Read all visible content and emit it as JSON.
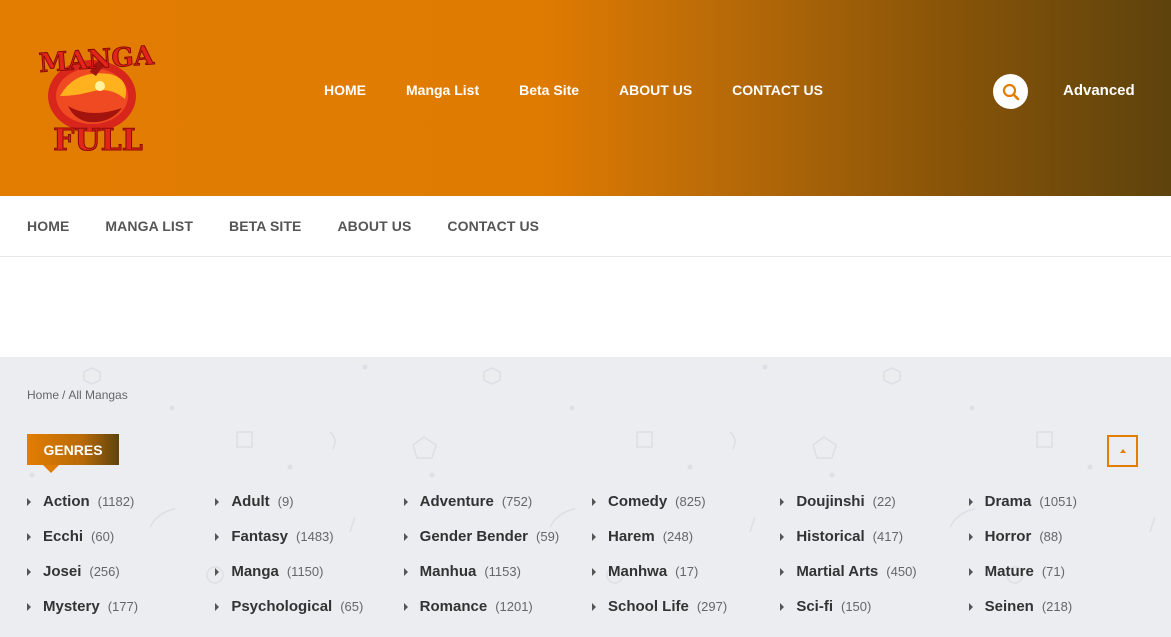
{
  "logo": {
    "line1": "MANGA",
    "line2": "FULL"
  },
  "top_nav": [
    "HOME",
    "Manga List",
    "Beta Site",
    "ABOUT US",
    "CONTACT US"
  ],
  "advanced_label": "Advanced",
  "sub_nav": [
    "HOME",
    "MANGA LIST",
    "BETA SITE",
    "ABOUT US",
    "CONTACT US"
  ],
  "breadcrumb": {
    "home": "Home",
    "sep": "/",
    "current": "All Mangas"
  },
  "genres_title": "GENRES",
  "icons": {
    "search": "search-icon",
    "scroll_top": "caret-up-icon",
    "genre_bullet": "caret-right-icon"
  },
  "colors": {
    "brand_orange": "#e27d02",
    "brand_dark": "#5e430d",
    "gray_bg": "#ebedf1"
  },
  "genres": [
    [
      {
        "name": "Action",
        "count": "(1182)"
      },
      {
        "name": "Adult",
        "count": "(9)"
      },
      {
        "name": "Adventure",
        "count": "(752)"
      },
      {
        "name": "Comedy",
        "count": "(825)"
      },
      {
        "name": "Doujinshi",
        "count": "(22)"
      },
      {
        "name": "Drama",
        "count": "(1051)"
      }
    ],
    [
      {
        "name": "Ecchi",
        "count": "(60)"
      },
      {
        "name": "Fantasy",
        "count": "(1483)"
      },
      {
        "name": "Gender Bender",
        "count": "(59)"
      },
      {
        "name": "Harem",
        "count": "(248)"
      },
      {
        "name": "Historical",
        "count": "(417)"
      },
      {
        "name": "Horror",
        "count": "(88)"
      }
    ],
    [
      {
        "name": "Josei",
        "count": "(256)"
      },
      {
        "name": "Manga",
        "count": "(1150)"
      },
      {
        "name": "Manhua",
        "count": "(1153)"
      },
      {
        "name": "Manhwa",
        "count": "(17)"
      },
      {
        "name": "Martial Arts",
        "count": "(450)"
      },
      {
        "name": "Mature",
        "count": "(71)"
      }
    ],
    [
      {
        "name": "Mystery",
        "count": "(177)"
      },
      {
        "name": "Psychological",
        "count": "(65)"
      },
      {
        "name": "Romance",
        "count": "(1201)"
      },
      {
        "name": "School Life",
        "count": "(297)"
      },
      {
        "name": "Sci-fi",
        "count": "(150)"
      },
      {
        "name": "Seinen",
        "count": "(218)"
      }
    ]
  ]
}
